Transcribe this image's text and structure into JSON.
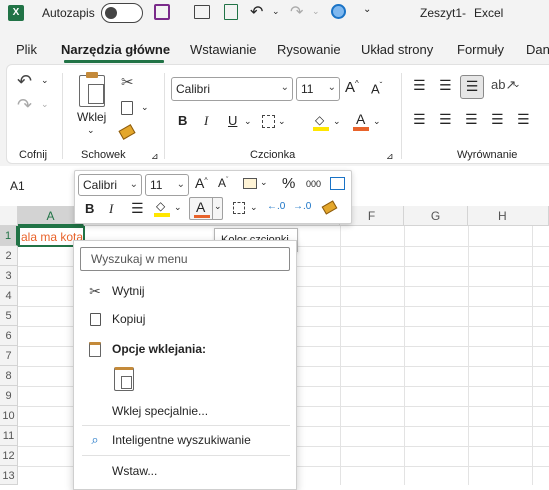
{
  "titlebar": {
    "autosave_label": "Autozapis",
    "document": "Zeszyt1",
    "separator": "-",
    "app": "Excel"
  },
  "tabs": [
    "Plik",
    "Narzędzia główne",
    "Wstawianie",
    "Rysowanie",
    "Układ strony",
    "Formuły",
    "Dan"
  ],
  "ribbon": {
    "undo_group": "Cofnij",
    "clipboard_group": "Schowek",
    "paste_label": "Wklej",
    "font_group": "Czcionka",
    "alignment_group": "Wyrównanie",
    "font_name": "Calibri",
    "font_size": "11",
    "bold": "B",
    "italic": "I",
    "underline": "U",
    "font_color_letter": "A"
  },
  "formula": {
    "name_box": "A1"
  },
  "grid": {
    "columns": [
      "A",
      "F",
      "G",
      "H"
    ],
    "rows": [
      "1",
      "2",
      "3",
      "4",
      "5",
      "6",
      "7",
      "8",
      "9",
      "10",
      "11",
      "12",
      "13"
    ],
    "cell_a1": "ala ma kota"
  },
  "mini_toolbar": {
    "font_name": "Calibri",
    "font_size": "11",
    "bold": "B",
    "italic": "I",
    "font_color_letter": "A",
    "percent": "%",
    "thousands": "000"
  },
  "tooltip": {
    "text": "Kolor czcionki"
  },
  "context_menu": {
    "search_placeholder": "Wyszukaj w menu",
    "cut": "Wytnij",
    "copy": "Kopiuj",
    "paste_options": "Opcje wklejania:",
    "paste_special": "Wklej specjalnie...",
    "smart_lookup": "Inteligentne wyszukiwanie",
    "insert": "Wstaw..."
  },
  "colors": {
    "excel_green": "#217346",
    "font_color_accent": "#e8632b",
    "highlight_yellow": "#ffe600",
    "titlebar_bg": "#f3f3f3"
  }
}
